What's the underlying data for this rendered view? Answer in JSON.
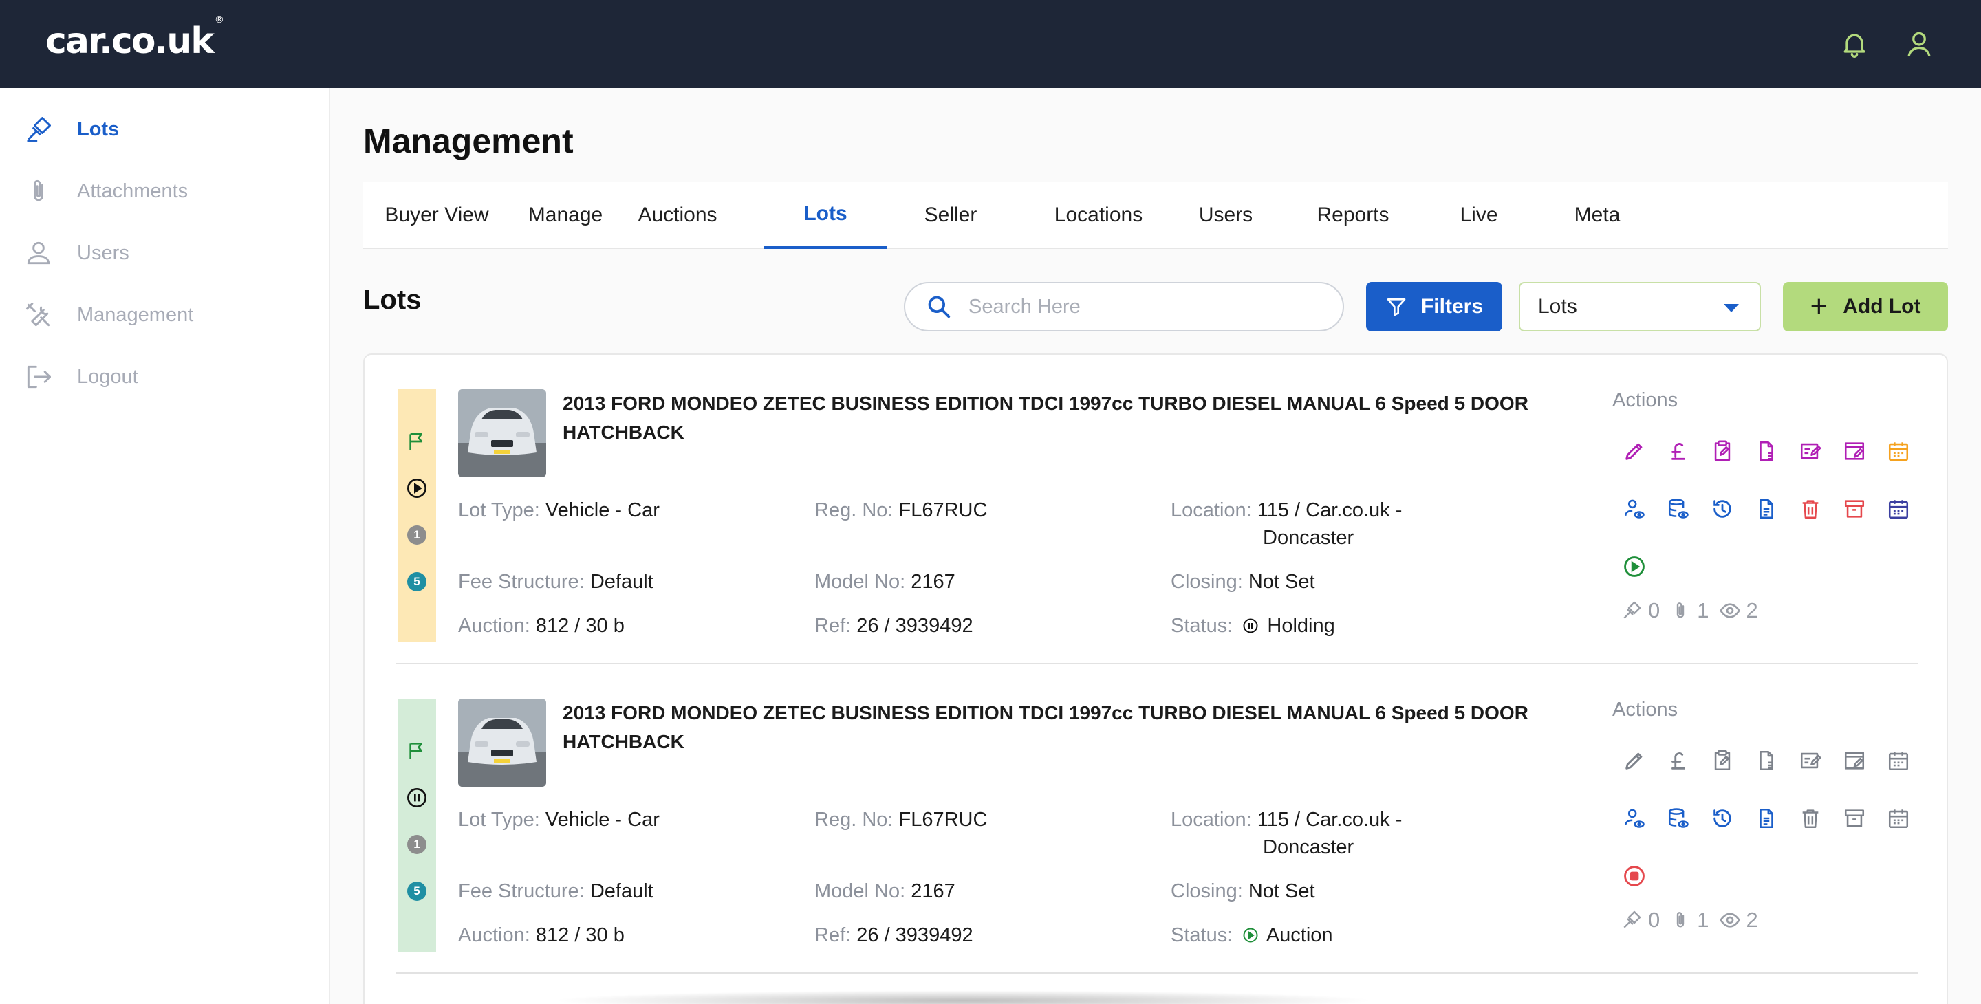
{
  "brand": {
    "logo_text": "car.co.uk",
    "logo_mark": "®"
  },
  "topbar": {
    "icons": [
      "bell-icon",
      "user-icon"
    ],
    "accent": "#b3da7d"
  },
  "sidebar": {
    "items": [
      {
        "label": "Lots",
        "icon": "gavel-icon",
        "active": true
      },
      {
        "label": "Attachments",
        "icon": "paperclip-icon",
        "active": false
      },
      {
        "label": "Users",
        "icon": "user-icon",
        "active": false
      },
      {
        "label": "Management",
        "icon": "tools-icon",
        "active": false
      },
      {
        "label": "Logout",
        "icon": "logout-icon",
        "active": false
      }
    ]
  },
  "page": {
    "title": "Management"
  },
  "tabs": [
    {
      "label": "Buyer View"
    },
    {
      "label": "Manage"
    },
    {
      "label": "Auctions"
    },
    {
      "label": "Lots",
      "active": true
    },
    {
      "label": "Seller"
    },
    {
      "label": "Locations"
    },
    {
      "label": "Users"
    },
    {
      "label": "Reports"
    },
    {
      "label": "Live"
    },
    {
      "label": "Meta"
    }
  ],
  "toolbar": {
    "section_title": "Lots",
    "search_placeholder": "Search Here",
    "filters_label": "Filters",
    "select_value": "Lots",
    "add_label": "Add Lot"
  },
  "labels": {
    "lot_type": "Lot Type:",
    "reg_no": "Reg. No:",
    "location": "Location:",
    "fee_structure": "Fee Structure:",
    "model_no": "Model No:",
    "closing": "Closing:",
    "auction": "Auction:",
    "ref": "Ref:",
    "status": "Status:",
    "actions": "Actions"
  },
  "lots": [
    {
      "title": "2013 FORD MONDEO ZETEC BUSINESS EDITION TDCI 1997cc TURBO DIESEL MANUAL 6 Speed 5 DOOR HATCHBACK",
      "strip_color": "#fde8b5",
      "state_icon": "play-circle-icon",
      "badge_1": "1",
      "badge_2": "5",
      "lot_type": "Vehicle - Car",
      "reg_no": "FL67RUC",
      "location_line1": "115 / Car.co.uk -",
      "location_line2": "Doncaster",
      "fee_structure": "Default",
      "model_no": "2167",
      "closing": "Not Set",
      "auction": "812 / 30 b",
      "ref": "26 / 3939492",
      "status": "Holding",
      "status_icon": "pause-circle-icon",
      "extra_action_icon": "play-circle-icon",
      "bids": "0",
      "attachments": "1",
      "views": "2"
    },
    {
      "title": "2013 FORD MONDEO ZETEC BUSINESS EDITION TDCI 1997cc TURBO DIESEL MANUAL 6 Speed 5 DOOR HATCHBACK",
      "strip_color": "#d4ecd8",
      "state_icon": "pause-circle-icon",
      "badge_1": "1",
      "badge_2": "5",
      "lot_type": "Vehicle - Car",
      "reg_no": "FL67RUC",
      "location_line1": "115 / Car.co.uk -",
      "location_line2": "Doncaster",
      "fee_structure": "Default",
      "model_no": "2167",
      "closing": "Not Set",
      "auction": "812 / 30 b",
      "ref": "26 / 3939492",
      "status": "Auction",
      "status_icon": "play-circle-icon",
      "extra_action_icon": "stop-circle-icon",
      "bids": "0",
      "attachments": "1",
      "views": "2"
    }
  ],
  "colors": {
    "primary": "#1a5ec9",
    "navbar": "#1e2637",
    "lime": "#b3da7d",
    "magenta": "#b01fb5",
    "orange": "#f5a21f",
    "red": "#e5484d",
    "green": "#1f8f3a",
    "teal": "#1f8fa3",
    "grey": "#8c919b"
  }
}
